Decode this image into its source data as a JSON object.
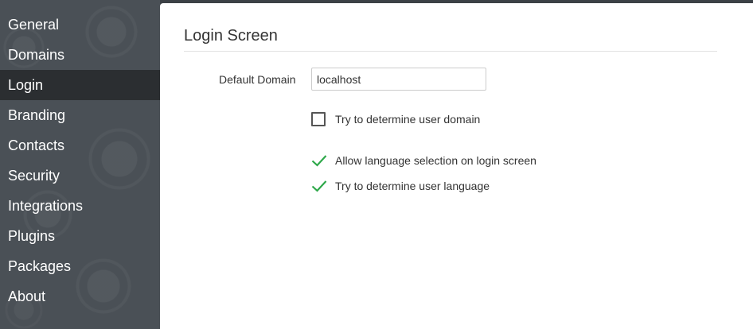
{
  "sidebar": {
    "items": [
      {
        "label": "General"
      },
      {
        "label": "Domains"
      },
      {
        "label": "Login",
        "active": true
      },
      {
        "label": "Branding"
      },
      {
        "label": "Contacts"
      },
      {
        "label": "Security"
      },
      {
        "label": "Integrations"
      },
      {
        "label": "Plugins"
      },
      {
        "label": "Packages"
      },
      {
        "label": "About"
      }
    ]
  },
  "main": {
    "title": "Login Screen",
    "default_domain_label": "Default Domain",
    "default_domain_value": "localhost",
    "options": [
      {
        "label": "Try to determine user domain",
        "checked": false
      },
      {
        "label": "Allow language selection on login screen",
        "checked": true
      },
      {
        "label": "Try to determine user language",
        "checked": true
      }
    ]
  },
  "colors": {
    "sidebar_bg": "#4a5056",
    "sidebar_active_bg": "#2b2e31",
    "check_green": "#2ea84a"
  }
}
